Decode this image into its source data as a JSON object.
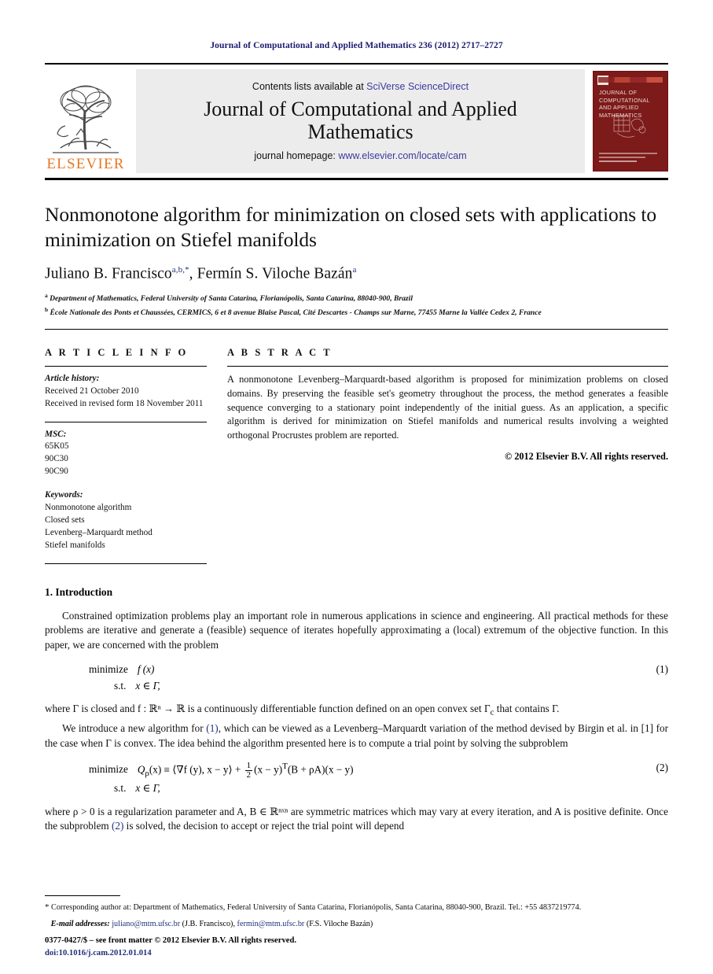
{
  "running_head": "Journal of Computational and Applied Mathematics 236 (2012) 2717–2727",
  "masthead": {
    "publisher_name": "ELSEVIER",
    "contents_prefix": "Contents lists available at ",
    "contents_link": "SciVerse ScienceDirect",
    "journal_title": "Journal of Computational and Applied Mathematics",
    "homepage_prefix": "journal homepage: ",
    "homepage_url": "www.elsevier.com/locate/cam",
    "cover_title": "JOURNAL OF COMPUTATIONAL AND APPLIED MATHEMATICS"
  },
  "article": {
    "title": "Nonmonotone algorithm for minimization on closed sets with applications to minimization on Stiefel manifolds",
    "authors": [
      {
        "name": "Juliano B. Francisco",
        "marks": "a,b,*"
      },
      {
        "name": "Fermín S. Viloche Bazán",
        "marks": "a"
      }
    ],
    "affiliations": [
      {
        "mark": "a",
        "text": "Department of Mathematics, Federal University of Santa Catarina, Florianópolis, Santa Catarina, 88040-900, Brazil"
      },
      {
        "mark": "b",
        "text": "École Nationale des Ponts et Chaussées, CERMICS, 6 et 8 avenue Blaise Pascal, Cité Descartes - Champs sur Marne, 77455 Marne la Vallée Cedex 2, France"
      }
    ]
  },
  "info": {
    "heading": "A R T I C L E   I N F O",
    "history_label": "Article history:",
    "history": [
      "Received 21 October 2010",
      "Received in revised form 18 November 2011"
    ],
    "msc_label": "MSC:",
    "msc": [
      "65K05",
      "90C30",
      "90C90"
    ],
    "keywords_label": "Keywords:",
    "keywords": [
      "Nonmonotone algorithm",
      "Closed sets",
      "Levenberg–Marquardt method",
      "Stiefel manifolds"
    ]
  },
  "abstract": {
    "heading": "A B S T R A C T",
    "text": "A nonmonotone Levenberg–Marquardt-based algorithm is proposed for minimization problems on closed domains. By preserving the feasible set's geometry throughout the process, the method generates a feasible sequence converging to a stationary point independently of the initial guess. As an application, a specific algorithm is derived for minimization on Stiefel manifolds and numerical results involving a weighted orthogonal Procrustes problem are reported.",
    "copyright": "© 2012 Elsevier B.V. All rights reserved."
  },
  "body": {
    "section_title": "1. Introduction",
    "para1": "Constrained optimization problems play an important role in numerous applications in science and engineering. All practical methods for these problems are iterative and generate a (feasible) sequence of iterates hopefully approximating a (local) extremum of the objective function. In this paper, we are concerned with the problem",
    "eq1": {
      "number": "(1)",
      "minimize_label": "minimize",
      "objective": "f (x)",
      "st_label": "s.t.",
      "constraint": "x ∈ Γ,"
    },
    "para2_a": "where ",
    "para2": "where Γ is closed and f : ℝⁿ → ℝ is a continuously differentiable function defined on an open convex set Γ",
    "para2_sub": "c",
    "para2_b": " that contains Γ.",
    "para3_a": "We introduce a new algorithm for ",
    "para3_ref": "(1)",
    "para3_b": ", which can be viewed as a Levenberg–Marquardt variation of the method devised by Birgin et al. in [1] for the case when Γ is convex. The idea behind the algorithm presented here is to compute a trial point by solving the subproblem",
    "eq2": {
      "number": "(2)",
      "minimize_label": "minimize",
      "objective_head": "Q",
      "objective_sub": "ρ",
      "objective_rest": "(x) ≡ ⟨∇f (y), x − y⟩ +",
      "frac_num": "1",
      "frac_den": "2",
      "objective_tail": "(x − y)",
      "objective_sup": "T",
      "objective_tail2": "(B + ρA)(x − y)",
      "st_label": "s.t.",
      "constraint": "x ∈ Γ,"
    },
    "para4_a": "where ρ > 0 is a regularization parameter and A, B ∈ ℝⁿˣⁿ are symmetric matrices which may vary at every iteration, and A is positive definite. Once the subproblem ",
    "para4_ref": "(2)",
    "para4_b": " is solved, the decision to accept or reject the trial point will depend"
  },
  "footnotes": {
    "corresponding": "Corresponding author at: Department of Mathematics, Federal University of Santa Catarina, Florianópolis, Santa Catarina, 88040-900, Brazil. Tel.: +55 4837219774.",
    "email_label": "E-mail addresses:",
    "emails": [
      {
        "address": "juliano@mtm.ufsc.br",
        "owner": "(J.B. Francisco)"
      },
      {
        "address": "fermin@mtm.ufsc.br",
        "owner": "(F.S. Viloche Bazán)"
      }
    ]
  },
  "colophon": {
    "issn_line": "0377-0427/$ – see front matter © 2012 Elsevier B.V. All rights reserved.",
    "doi": "doi:10.1016/j.cam.2012.01.014"
  },
  "colors": {
    "link": "#1f2f7a",
    "elsevier_orange": "#e87722",
    "cover_red": "#7d1a1a",
    "running_head": "#1a1a6e"
  }
}
